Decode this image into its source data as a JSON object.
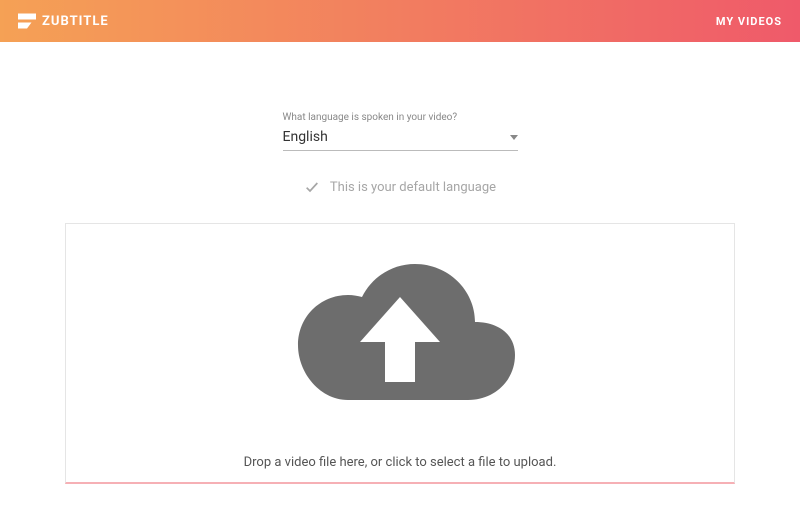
{
  "header": {
    "brand": "ZUBTITLE",
    "nav_my_videos": "MY VIDEOS"
  },
  "language": {
    "prompt": "What language is spoken in your video?",
    "selected": "English",
    "default_msg": "This is your default language"
  },
  "uploader": {
    "instruction": "Drop a video file here, or click to select a file to upload."
  }
}
